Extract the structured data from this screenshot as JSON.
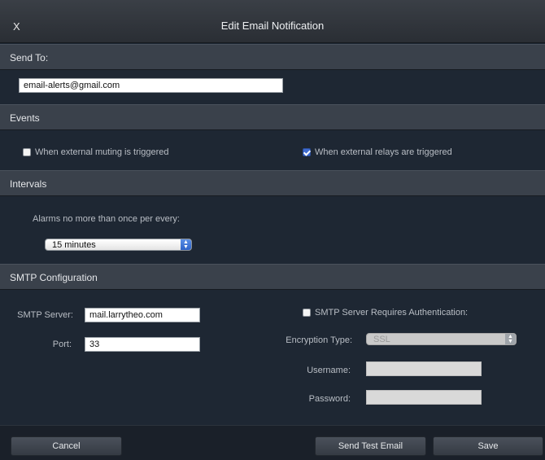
{
  "window": {
    "close_label": "X",
    "title": "Edit Email Notification"
  },
  "send_to": {
    "header": "Send To:",
    "email_value": "email-alerts@gmail.com"
  },
  "events": {
    "header": "Events",
    "muting_label": "When external muting is triggered",
    "muting_checked": false,
    "relays_label": "When external relays are triggered",
    "relays_checked": true
  },
  "intervals": {
    "header": "Intervals",
    "description": "Alarms no more than once per every:",
    "selected": "15 minutes"
  },
  "smtp": {
    "header": "SMTP Configuration",
    "server_label": "SMTP Server:",
    "server_value": "mail.larrytheo.com",
    "port_label": "Port:",
    "port_value": "33",
    "auth_label": "SMTP Server Requires Authentication:",
    "auth_checked": false,
    "encryption_label": "Encryption Type:",
    "encryption_value": "SSL",
    "username_label": "Username:",
    "username_value": "",
    "password_label": "Password:",
    "password_value": ""
  },
  "footer": {
    "cancel": "Cancel",
    "send_test": "Send Test Email",
    "save": "Save"
  },
  "colors": {
    "background": "#1e2733",
    "section_header": "#3a414b",
    "accent_blue": "#3f6bd0"
  }
}
